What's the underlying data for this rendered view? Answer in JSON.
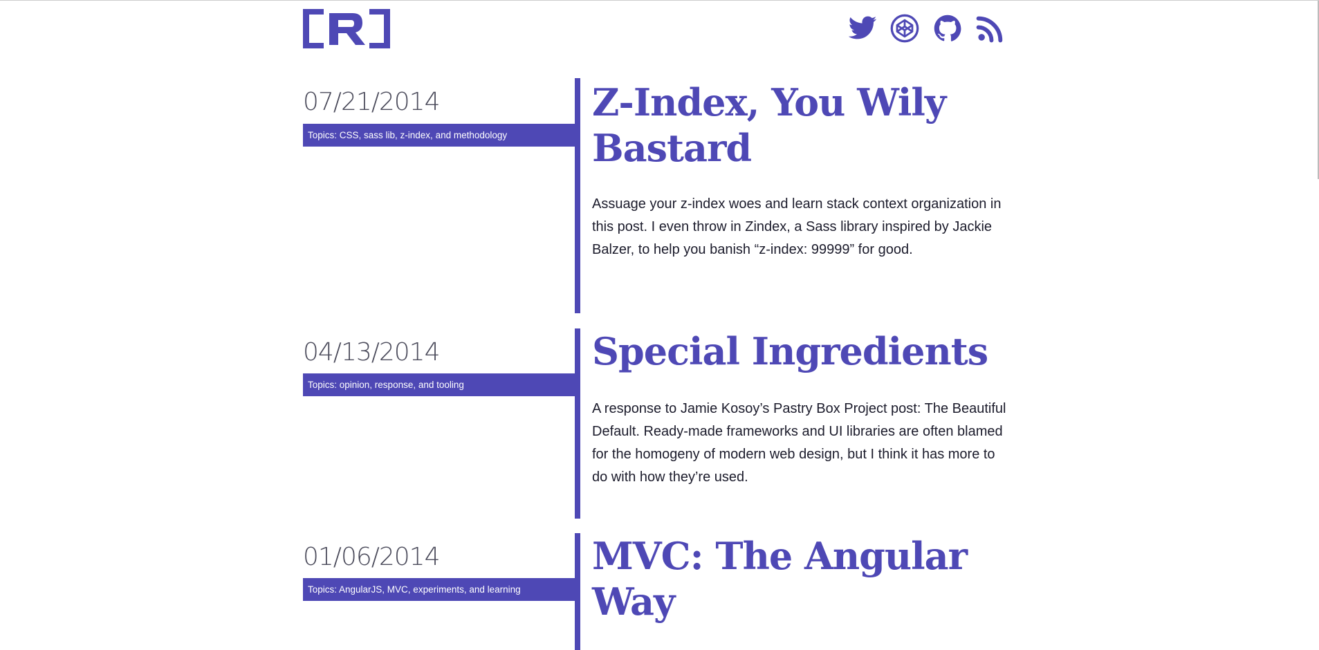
{
  "site": {
    "logo_text": "[R]",
    "brand_color": "#4e48b5"
  },
  "header": {
    "social": [
      {
        "name": "twitter",
        "icon": "twitter-icon"
      },
      {
        "name": "codepen",
        "icon": "codepen-icon"
      },
      {
        "name": "github",
        "icon": "github-icon"
      },
      {
        "name": "rss",
        "icon": "rss-icon"
      }
    ]
  },
  "posts": [
    {
      "date": "07/21/2014",
      "topics": "Topics: CSS, sass lib, z-index, and methodology",
      "title": "Z-Index, You Wily Bastard",
      "excerpt": "Assuage your z-index woes and learn stack context organization in this post. I even throw in Zindex, a Sass library inspired by Jackie Balzer, to help you banish “z-index: 99999” for good."
    },
    {
      "date": "04/13/2014",
      "topics": "Topics: opinion, response, and tooling",
      "title": "Special Ingredients",
      "excerpt": "A response to Jamie Kosoy’s Pastry Box Project post: The Beautiful Default. Ready-made frameworks and UI libraries are often blamed for the homogeny of modern web design, but I think it has more to do with how they’re used."
    },
    {
      "date": "01/06/2014",
      "topics": "Topics: AngularJS, MVC, experiments, and learning",
      "title": "MVC: The Angular Way",
      "excerpt": ""
    }
  ]
}
